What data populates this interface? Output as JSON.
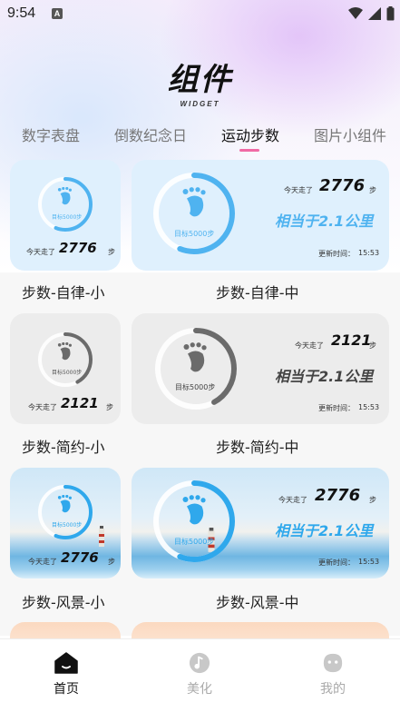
{
  "status_bar": {
    "time": "9:54",
    "notif_icon_letter": "A"
  },
  "header": {
    "title": "组件",
    "subtitle": "WIDGET"
  },
  "tabs": [
    {
      "label": "数字表盘"
    },
    {
      "label": "倒数纪念日"
    },
    {
      "label": "运动步数"
    },
    {
      "label": "图片小组件"
    }
  ],
  "active_tab_index": 2,
  "widgets": [
    {
      "name": "步数-自律-小",
      "today_prefix": "今天走了",
      "steps": "2776",
      "unit": "步",
      "goal": "目标5000步",
      "ring_color": "#4fb3f0",
      "progress": 0.56
    },
    {
      "name": "步数-自律-中",
      "today_prefix": "今天走了",
      "steps": "2776",
      "unit": "步",
      "goal": "目标5000步",
      "equiv": "相当于2.1公里",
      "updated_label": "更新时间：",
      "updated_time": "15:53",
      "ring_color": "#4fb3f0",
      "accent": "#4fb3f0",
      "progress": 0.56
    },
    {
      "name": "步数-简约-小",
      "today_prefix": "今天走了",
      "steps": "2121",
      "unit": "步",
      "goal": "目标5000步",
      "ring_color": "#6b6b6b",
      "progress": 0.42
    },
    {
      "name": "步数-简约-中",
      "today_prefix": "今天走了",
      "steps": "2121",
      "unit": "步",
      "goal": "目标5000步",
      "equiv": "相当于2.1公里",
      "updated_label": "更新时间：",
      "updated_time": "15:53",
      "ring_color": "#6b6b6b",
      "accent": "#444444",
      "progress": 0.42
    },
    {
      "name": "步数-风景-小",
      "today_prefix": "今天走了",
      "steps": "2776",
      "unit": "步",
      "goal": "目标5000步",
      "ring_color": "#2fa8ec",
      "progress": 0.56
    },
    {
      "name": "步数-风景-中",
      "today_prefix": "今天走了",
      "steps": "2776",
      "unit": "步",
      "goal": "目标5000步",
      "equiv": "相当于2.1公里",
      "updated_label": "更新时间：",
      "updated_time": "15:53",
      "ring_color": "#2fa8ec",
      "accent": "#2fa8ec",
      "progress": 0.56
    }
  ],
  "bottom_nav": [
    {
      "label": "首页",
      "icon": "home-icon",
      "active": true
    },
    {
      "label": "美化",
      "icon": "music-disc-icon",
      "active": false
    },
    {
      "label": "我的",
      "icon": "face-icon",
      "active": false
    }
  ],
  "colors": {
    "tab_indicator": "#f06aa5",
    "nav_active": "#111111",
    "nav_inactive": "#aaaaaa"
  }
}
